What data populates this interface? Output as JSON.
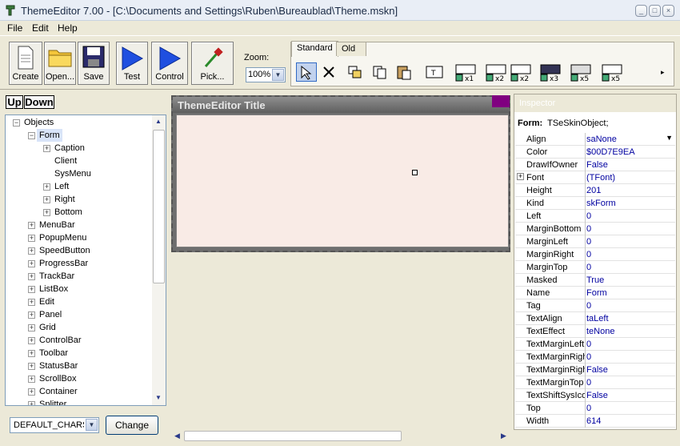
{
  "window": {
    "title": "ThemeEditor 7.00 - [C:\\Documents and Settings\\Ruben\\Bureaublad\\Theme.mskn]"
  },
  "menu": [
    "File",
    "Edit",
    "Help"
  ],
  "toolbar": {
    "buttons": [
      {
        "label": "Create",
        "icon": "new-file-icon"
      },
      {
        "label": "Open...",
        "icon": "folder-icon"
      },
      {
        "label": "Save",
        "icon": "floppy-icon"
      },
      {
        "label": "Test",
        "icon": "play-icon"
      },
      {
        "label": "Control",
        "icon": "play-icon"
      },
      {
        "label": "Pick...",
        "icon": "eyedropper-icon"
      }
    ],
    "zoom_label": "Zoom:",
    "zoom_value": "100%",
    "tabs": [
      "Standard",
      "Old"
    ],
    "active_tab": "Standard"
  },
  "left": {
    "up_label": "Up",
    "down_label": "Down",
    "tree": [
      {
        "label": "Objects",
        "level": 0,
        "expanded": true,
        "selected": false
      },
      {
        "label": "Form",
        "level": 1,
        "expanded": true,
        "selected": true
      },
      {
        "label": "Caption",
        "level": 2,
        "expanded": false,
        "selected": false
      },
      {
        "label": "Client",
        "level": 2,
        "leaf": true
      },
      {
        "label": "SysMenu",
        "level": 2,
        "leaf": true
      },
      {
        "label": "Left",
        "level": 2,
        "expanded": false
      },
      {
        "label": "Right",
        "level": 2,
        "expanded": false
      },
      {
        "label": "Bottom",
        "level": 2,
        "expanded": false
      },
      {
        "label": "MenuBar",
        "level": 1,
        "expanded": false
      },
      {
        "label": "PopupMenu",
        "level": 1,
        "expanded": false
      },
      {
        "label": "SpeedButton",
        "level": 1,
        "expanded": false
      },
      {
        "label": "ProgressBar",
        "level": 1,
        "expanded": false
      },
      {
        "label": "TrackBar",
        "level": 1,
        "expanded": false
      },
      {
        "label": "ListBox",
        "level": 1,
        "expanded": false
      },
      {
        "label": "Edit",
        "level": 1,
        "expanded": false
      },
      {
        "label": "Panel",
        "level": 1,
        "expanded": false
      },
      {
        "label": "Grid",
        "level": 1,
        "expanded": false
      },
      {
        "label": "ControlBar",
        "level": 1,
        "expanded": false
      },
      {
        "label": "Toolbar",
        "level": 1,
        "expanded": false
      },
      {
        "label": "StatusBar",
        "level": 1,
        "expanded": false
      },
      {
        "label": "ScrollBox",
        "level": 1,
        "expanded": false
      },
      {
        "label": "Container",
        "level": 1,
        "expanded": false
      },
      {
        "label": "Splitter",
        "level": 1,
        "expanded": false
      }
    ],
    "charset_value": "DEFAULT_CHARSET",
    "change_label": "Change"
  },
  "design": {
    "form_title": "ThemeEditor Title"
  },
  "inspector": {
    "header": "Inspector",
    "object_label": "Form:",
    "object_type": "TSeSkinObject;",
    "properties": [
      {
        "name": "Align",
        "value": "saNone",
        "dropdown": true
      },
      {
        "name": "Color",
        "value": "$00D7E9EA"
      },
      {
        "name": "DrawIfOwner",
        "value": "False"
      },
      {
        "name": "Font",
        "value": "(TFont)",
        "expandable": true
      },
      {
        "name": "Height",
        "value": "201"
      },
      {
        "name": "Kind",
        "value": "skForm"
      },
      {
        "name": "Left",
        "value": "0"
      },
      {
        "name": "MarginBottom",
        "value": "0"
      },
      {
        "name": "MarginLeft",
        "value": "0"
      },
      {
        "name": "MarginRight",
        "value": "0"
      },
      {
        "name": "MarginTop",
        "value": "0"
      },
      {
        "name": "Masked",
        "value": "True"
      },
      {
        "name": "Name",
        "value": "Form"
      },
      {
        "name": "Tag",
        "value": "0"
      },
      {
        "name": "TextAlign",
        "value": "taLeft"
      },
      {
        "name": "TextEffect",
        "value": "teNone"
      },
      {
        "name": "TextMarginLeft",
        "value": "0"
      },
      {
        "name": "TextMarginRight",
        "value": "0"
      },
      {
        "name": "TextMarginRightShadow",
        "value": "False"
      },
      {
        "name": "TextMarginTop",
        "value": "0"
      },
      {
        "name": "TextShiftSysIcon",
        "value": "False"
      },
      {
        "name": "Top",
        "value": "0"
      },
      {
        "name": "Width",
        "value": "614"
      }
    ]
  },
  "colors": {
    "accent": "#316ac5",
    "form_client": "#f9ebe6",
    "form_corner": "#800080"
  }
}
